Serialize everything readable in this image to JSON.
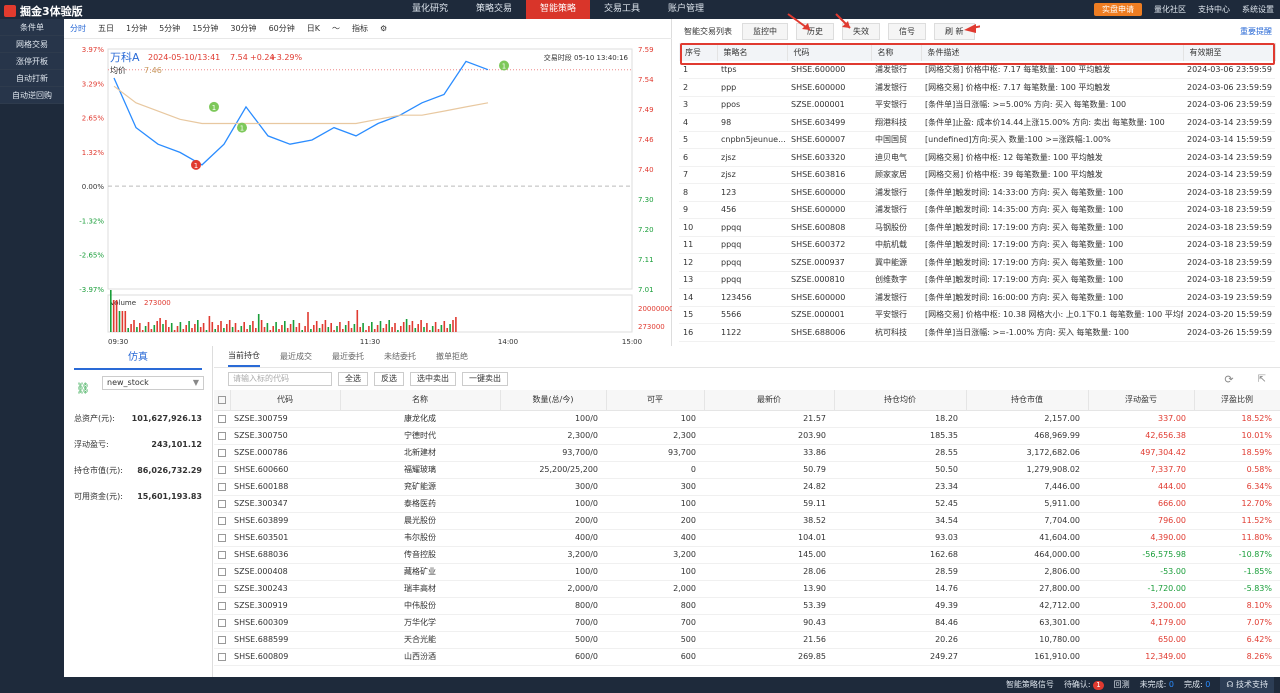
{
  "app": {
    "title": "掘金3体验版"
  },
  "nav": [
    "量化研究",
    "策略交易",
    "智能策略",
    "交易工具",
    "账户管理"
  ],
  "nav_active": 2,
  "top_right": {
    "apply": "实盘申请",
    "community": "量化社区",
    "support": "支持中心",
    "settings": "系统设置"
  },
  "left_nav": [
    "条件单",
    "网格交易",
    "涨停开板",
    "自动打新",
    "自动逆回购"
  ],
  "chart": {
    "periods": [
      "分时",
      "五日",
      "1分钟",
      "5分钟",
      "15分钟",
      "30分钟",
      "60分钟",
      "日K",
      "指标"
    ],
    "stock": "万科A",
    "datetime": "2024-05-10/13:41",
    "price": "7.54",
    "change": "+0.24",
    "pct": "+3.29%",
    "avg_label": "均价",
    "avg": "7.46",
    "session": "交易时段 05-10 13:40:16",
    "left_ticks": [
      "3.97%",
      "3.29%",
      "2.65%",
      "1.32%",
      "0.00%",
      "-1.32%",
      "-2.65%",
      "-3.97%"
    ],
    "right_ticks": [
      "7.59",
      "7.54",
      "7.49",
      "7.46",
      "7.40",
      "7.30",
      "7.20",
      "7.11",
      "7.01"
    ],
    "volume_label": "Volume",
    "volume": "273000",
    "vol_tick": "20000000",
    "vol_badge": "273000",
    "time_ticks": [
      "09:30",
      "11:30",
      "14:00",
      "15:00"
    ],
    "markers": [
      "1",
      "1",
      "1",
      "1"
    ]
  },
  "chart_data": {
    "type": "line",
    "title": "万科A",
    "x": [
      "09:30",
      "09:40",
      "09:50",
      "10:00",
      "10:10",
      "10:20",
      "10:30",
      "10:40",
      "10:50",
      "11:00",
      "11:10",
      "11:20",
      "11:30",
      "13:10",
      "13:20",
      "13:30",
      "13:40",
      "13:41"
    ],
    "series": [
      {
        "name": "价格",
        "values": [
          7.52,
          7.4,
          7.36,
          7.34,
          7.31,
          7.36,
          7.45,
          7.38,
          7.36,
          7.37,
          7.4,
          7.38,
          7.41,
          7.43,
          7.46,
          7.48,
          7.56,
          7.54
        ]
      },
      {
        "name": "均价",
        "values": [
          7.5,
          7.46,
          7.44,
          7.42,
          7.41,
          7.41,
          7.41,
          7.41,
          7.41,
          7.41,
          7.41,
          7.41,
          7.42,
          7.43,
          7.43,
          7.44,
          7.45,
          7.46
        ]
      }
    ],
    "ylim": [
      7.01,
      7.59
    ],
    "xlabel": "",
    "ylabel": ""
  },
  "strat": {
    "title": "智能交易列表",
    "tabs": [
      "监控中",
      "历史",
      "失效",
      "信号"
    ],
    "refresh": "刷 新",
    "help": "重要提醒",
    "headers": [
      "序号",
      "策略名",
      "代码",
      "名称",
      "条件描述",
      "有效期至"
    ],
    "rows": [
      [
        "1",
        "ttps",
        "SHSE.600000",
        "浦发银行",
        "[网格交易] 价格中枢: 7.17 每笔数量: 100 平均触发",
        "2024-03-06 23:59:59"
      ],
      [
        "2",
        "ppp",
        "SHSE.600000",
        "浦发银行",
        "[网格交易] 价格中枢: 7.17 每笔数量: 100 平均触发",
        "2024-03-06 23:59:59"
      ],
      [
        "3",
        "ppos",
        "SZSE.000001",
        "平安银行",
        "[条件单]当日涨幅: >=5.00% 方向: 买入 每笔数量: 100",
        "2024-03-06 23:59:59"
      ],
      [
        "4",
        "98",
        "SHSE.603499",
        "翔港科技",
        "[条件单]止盈: 成本价14.44上涨15.00% 方向: 卖出 每笔数量: 100",
        "2024-03-14 23:59:59"
      ],
      [
        "5",
        "cnpbn5jeunue...",
        "SHSE.600007",
        "中国国贸",
        "[undefined]方向:买入 数量:100 >=涨跌幅:1.00%",
        "2024-03-14 15:59:59"
      ],
      [
        "6",
        "zjsz",
        "SHSE.603320",
        "迪贝电气",
        "[网格交易] 价格中枢: 12 每笔数量: 100 平均触发",
        "2024-03-14 23:59:59"
      ],
      [
        "7",
        "zjsz",
        "SHSE.603816",
        "顾家家居",
        "[网格交易] 价格中枢: 39 每笔数量: 100 平均触发",
        "2024-03-14 23:59:59"
      ],
      [
        "8",
        "123",
        "SHSE.600000",
        "浦发银行",
        "[条件单]触发时间: 14:33:00 方向: 买入 每笔数量: 100",
        "2024-03-18 23:59:59"
      ],
      [
        "9",
        "456",
        "SHSE.600000",
        "浦发银行",
        "[条件单]触发时间: 14:35:00 方向: 买入 每笔数量: 100",
        "2024-03-18 23:59:59"
      ],
      [
        "10",
        "ppqq",
        "SHSE.600808",
        "马钢股份",
        "[条件单]触发时间: 17:19:00 方向: 买入 每笔数量: 100",
        "2024-03-18 23:59:59"
      ],
      [
        "11",
        "ppqq",
        "SHSE.600372",
        "中航机载",
        "[条件单]触发时间: 17:19:00 方向: 买入 每笔数量: 100",
        "2024-03-18 23:59:59"
      ],
      [
        "12",
        "ppqq",
        "SZSE.000937",
        "冀中能源",
        "[条件单]触发时间: 17:19:00 方向: 买入 每笔数量: 100",
        "2024-03-18 23:59:59"
      ],
      [
        "13",
        "ppqq",
        "SZSE.000810",
        "创维数字",
        "[条件单]触发时间: 17:19:00 方向: 买入 每笔数量: 100",
        "2024-03-18 23:59:59"
      ],
      [
        "14",
        "123456",
        "SHSE.600000",
        "浦发银行",
        "[条件单]触发时间: 16:00:00 方向: 买入 每笔数量: 100",
        "2024-03-19 23:59:59"
      ],
      [
        "15",
        "5566",
        "SZSE.000001",
        "平安银行",
        "[网格交易] 价格中枢: 10.38 网格大小: 上0.1下0.1 每笔数量: 100 平均触发",
        "2024-03-20 15:59:59"
      ],
      [
        "16",
        "1122",
        "SHSE.688006",
        "杭可科技",
        "[条件单]当日涨幅: >=-1.00% 方向: 买入 每笔数量: 100",
        "2024-03-26 15:59:59"
      ]
    ]
  },
  "account": {
    "title": "仿真",
    "select": "new_stock",
    "rows": [
      [
        "总资产(元):",
        "101,627,926.13"
      ],
      [
        "浮动盈亏:",
        "243,101.12"
      ],
      [
        "持仓市值(元):",
        "86,026,732.29"
      ],
      [
        "可用资金(元):",
        "15,601,193.83"
      ]
    ]
  },
  "positions": {
    "tabs": [
      "当前持仓",
      "最近成交",
      "最近委托",
      "未结委托",
      "撤单拒绝"
    ],
    "search_placeholder": "请输入标的代码",
    "buttons": [
      "全选",
      "反选",
      "选中卖出",
      "一键卖出"
    ],
    "headers": [
      "代码",
      "名称",
      "数量(总/今)",
      "可平",
      "最新价",
      "持仓均价",
      "持仓市值",
      "浮动盈亏",
      "浮盈比例"
    ],
    "rows": [
      [
        "SZSE.300759",
        "康龙化成",
        "100/0",
        "100",
        "21.57",
        "18.20",
        "2,157.00",
        "337.00",
        "18.52%",
        "r"
      ],
      [
        "SZSE.300750",
        "宁德时代",
        "2,300/0",
        "2,300",
        "203.90",
        "185.35",
        "468,969.99",
        "42,656.38",
        "10.01%",
        "r"
      ],
      [
        "SZSE.000786",
        "北新建材",
        "93,700/0",
        "93,700",
        "33.86",
        "28.55",
        "3,172,682.06",
        "497,304.42",
        "18.59%",
        "r"
      ],
      [
        "SHSE.600660",
        "福耀玻璃",
        "25,200/25,200",
        "0",
        "50.79",
        "50.50",
        "1,279,908.02",
        "7,337.70",
        "0.58%",
        "r"
      ],
      [
        "SHSE.600188",
        "兖矿能源",
        "300/0",
        "300",
        "24.82",
        "23.34",
        "7,446.00",
        "444.00",
        "6.34%",
        "r"
      ],
      [
        "SZSE.300347",
        "泰格医药",
        "100/0",
        "100",
        "59.11",
        "52.45",
        "5,911.00",
        "666.00",
        "12.70%",
        "r"
      ],
      [
        "SHSE.603899",
        "晨光股份",
        "200/0",
        "200",
        "38.52",
        "34.54",
        "7,704.00",
        "796.00",
        "11.52%",
        "r"
      ],
      [
        "SHSE.603501",
        "韦尔股份",
        "400/0",
        "400",
        "104.01",
        "93.03",
        "41,604.00",
        "4,390.00",
        "11.80%",
        "r"
      ],
      [
        "SHSE.688036",
        "传音控股",
        "3,200/0",
        "3,200",
        "145.00",
        "162.68",
        "464,000.00",
        "-56,575.98",
        "-10.87%",
        "g"
      ],
      [
        "SZSE.000408",
        "藏格矿业",
        "100/0",
        "100",
        "28.06",
        "28.59",
        "2,806.00",
        "-53.00",
        "-1.85%",
        "g"
      ],
      [
        "SZSE.300243",
        "瑞丰高材",
        "2,000/0",
        "2,000",
        "13.90",
        "14.76",
        "27,800.00",
        "-1,720.00",
        "-5.83%",
        "g"
      ],
      [
        "SZSE.300919",
        "中伟股份",
        "800/0",
        "800",
        "53.39",
        "49.39",
        "42,712.00",
        "3,200.00",
        "8.10%",
        "r"
      ],
      [
        "SHSE.600309",
        "万华化学",
        "700/0",
        "700",
        "90.43",
        "84.46",
        "63,301.00",
        "4,179.00",
        "7.07%",
        "r"
      ],
      [
        "SHSE.688599",
        "天合光能",
        "500/0",
        "500",
        "21.56",
        "20.26",
        "10,780.00",
        "650.00",
        "6.42%",
        "r"
      ],
      [
        "SHSE.600809",
        "山西汾酒",
        "600/0",
        "600",
        "269.85",
        "249.27",
        "161,910.00",
        "12,349.00",
        "8.26%",
        "r"
      ]
    ]
  },
  "status": {
    "signal": "智能策略信号",
    "pending": "待确认:",
    "pending_n": "1",
    "done": "回测",
    "undone": "未完成:",
    "undone_n": "0",
    "finished": "完成:",
    "finished_n": "0",
    "support": "技术支持"
  }
}
